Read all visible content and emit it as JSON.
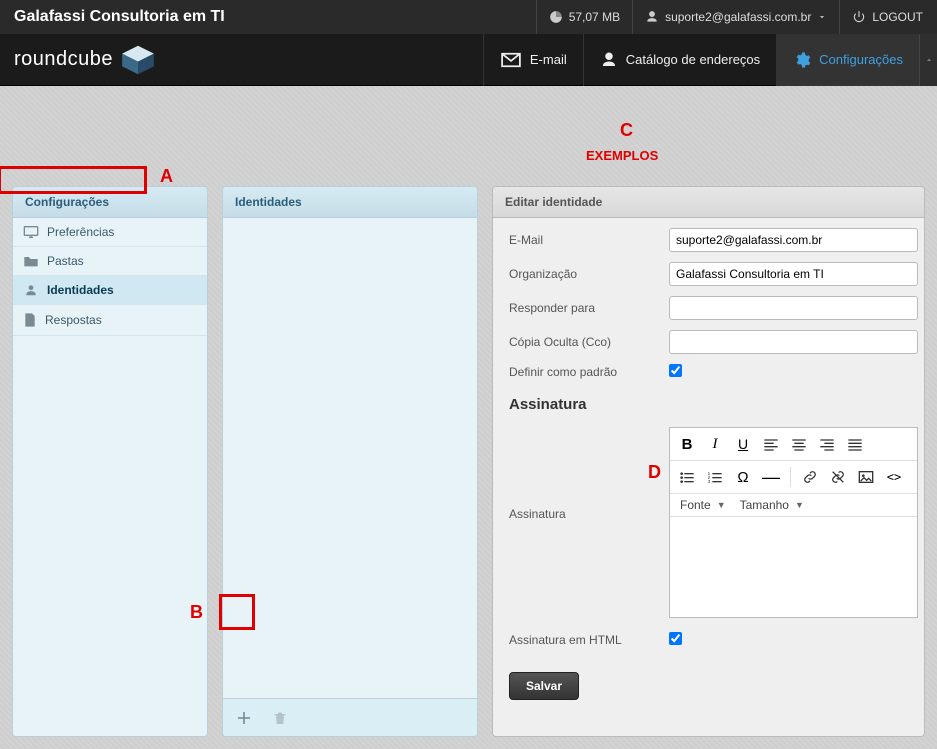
{
  "topbar": {
    "brand": "Galafassi Consultoria em TI",
    "storage": "57,07 MB",
    "user": "suporte2@galafassi.com.br",
    "logout": "LOGOUT"
  },
  "nav": {
    "logo": "roundcube",
    "email": "E-mail",
    "contacts": "Catálogo de endereços",
    "settings": "Configurações"
  },
  "left": {
    "header": "Configurações",
    "items": [
      {
        "label": "Preferências",
        "icon": "monitor"
      },
      {
        "label": "Pastas",
        "icon": "folder"
      },
      {
        "label": "Identidades",
        "icon": "identity"
      },
      {
        "label": "Respostas",
        "icon": "file"
      }
    ]
  },
  "mid": {
    "header": "Identidades"
  },
  "right": {
    "header": "Editar identidade",
    "fields": {
      "email_label": "E-Mail",
      "email_value": "suporte2@galafassi.com.br",
      "org_label": "Organização",
      "org_value": "Galafassi Consultoria em TI",
      "reply_label": "Responder para",
      "reply_value": "",
      "bcc_label": "Cópia Oculta (Cco)",
      "bcc_value": "",
      "default_label": "Definir como padrão"
    },
    "signature": {
      "title": "Assinatura",
      "label": "Assinatura",
      "font": "Fonte",
      "size": "Tamanho",
      "html_label": "Assinatura em HTML"
    },
    "save": "Salvar"
  },
  "annotations": {
    "A": "A",
    "B": "B",
    "C": "C",
    "D": "D",
    "exemplos": "EXEMPLOS"
  }
}
